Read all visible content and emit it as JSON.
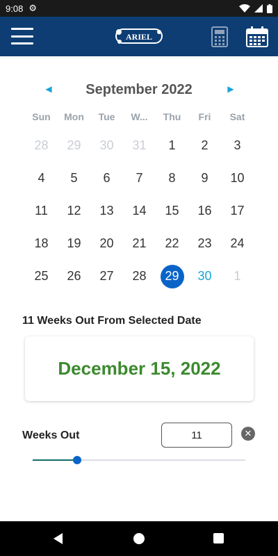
{
  "status_bar": {
    "time": "9:08"
  },
  "app_bar": {
    "logo_text": "ARIEL"
  },
  "calendar": {
    "month_title": "September 2022",
    "weekdays": [
      "Sun",
      "Mon",
      "Tue",
      "W...",
      "Thu",
      "Fri",
      "Sat"
    ],
    "weeks": [
      [
        {
          "d": "28",
          "state": "other"
        },
        {
          "d": "29",
          "state": "other"
        },
        {
          "d": "30",
          "state": "other"
        },
        {
          "d": "31",
          "state": "other"
        },
        {
          "d": "1",
          "state": "normal"
        },
        {
          "d": "2",
          "state": "normal"
        },
        {
          "d": "3",
          "state": "normal"
        }
      ],
      [
        {
          "d": "4",
          "state": "normal"
        },
        {
          "d": "5",
          "state": "normal"
        },
        {
          "d": "6",
          "state": "normal"
        },
        {
          "d": "7",
          "state": "normal"
        },
        {
          "d": "8",
          "state": "normal"
        },
        {
          "d": "9",
          "state": "normal"
        },
        {
          "d": "10",
          "state": "normal"
        }
      ],
      [
        {
          "d": "11",
          "state": "normal"
        },
        {
          "d": "12",
          "state": "normal"
        },
        {
          "d": "13",
          "state": "normal"
        },
        {
          "d": "14",
          "state": "normal"
        },
        {
          "d": "15",
          "state": "normal"
        },
        {
          "d": "16",
          "state": "normal"
        },
        {
          "d": "17",
          "state": "normal"
        }
      ],
      [
        {
          "d": "18",
          "state": "normal"
        },
        {
          "d": "19",
          "state": "normal"
        },
        {
          "d": "20",
          "state": "normal"
        },
        {
          "d": "21",
          "state": "normal"
        },
        {
          "d": "22",
          "state": "normal"
        },
        {
          "d": "23",
          "state": "normal"
        },
        {
          "d": "24",
          "state": "normal"
        }
      ],
      [
        {
          "d": "25",
          "state": "normal"
        },
        {
          "d": "26",
          "state": "normal"
        },
        {
          "d": "27",
          "state": "normal"
        },
        {
          "d": "28",
          "state": "normal"
        },
        {
          "d": "29",
          "state": "selected"
        },
        {
          "d": "30",
          "state": "next-avail"
        },
        {
          "d": "1",
          "state": "other"
        }
      ]
    ]
  },
  "result": {
    "section_title": "11 Weeks Out From Selected Date",
    "date": "December 15, 2022"
  },
  "weeks_out": {
    "label": "Weeks Out",
    "value": "11",
    "slider_fraction": 0.21
  },
  "colors": {
    "app_bar": "#0d3d73",
    "accent_blue": "#0a64c8",
    "result_green": "#3c8a2e",
    "link_cyan": "#1aa3d9"
  },
  "icons": {
    "menu": "hamburger-icon",
    "calculator": "calculator-icon",
    "calendar": "calendar-icon",
    "clear": "close-icon"
  }
}
